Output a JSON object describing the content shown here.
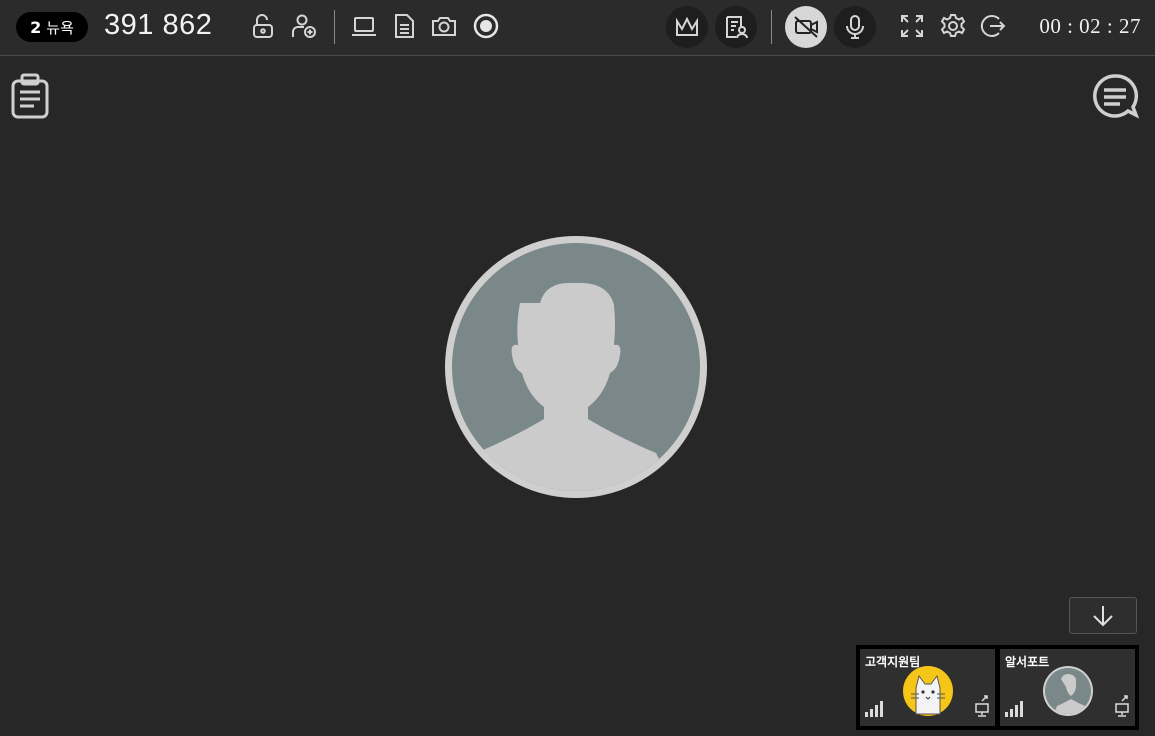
{
  "header": {
    "participant_count": "2",
    "new_label": "뉴욕",
    "room_number": "391 862",
    "timer": "00 : 02 : 27"
  },
  "toolbar": {
    "left_icons": [
      "lock-open-icon",
      "user-add-icon",
      "laptop-icon",
      "document-icon",
      "camera-icon",
      "record-icon"
    ],
    "right_icons": [
      "crown-icon",
      "attendees-list-icon",
      "video-off-icon",
      "microphone-icon",
      "fullscreen-icon",
      "gear-icon",
      "exit-icon"
    ]
  },
  "main": {
    "left_icon": "clipboard-icon",
    "right_icon": "chat-icon",
    "avatar": "person-placeholder-icon"
  },
  "scroll_button": {
    "icon": "arrow-down-icon"
  },
  "participants": [
    {
      "name": "고객지원팀",
      "avatar": "cat-avatar-icon"
    },
    {
      "name": "알서포트",
      "avatar": "person-placeholder-icon"
    }
  ],
  "colors": {
    "background": "#272727",
    "topbar": "#2b2b2b",
    "avatar_bg": "#7a8889",
    "avatar_fg": "#cbcbcb",
    "cat_bg": "#f5c518"
  }
}
